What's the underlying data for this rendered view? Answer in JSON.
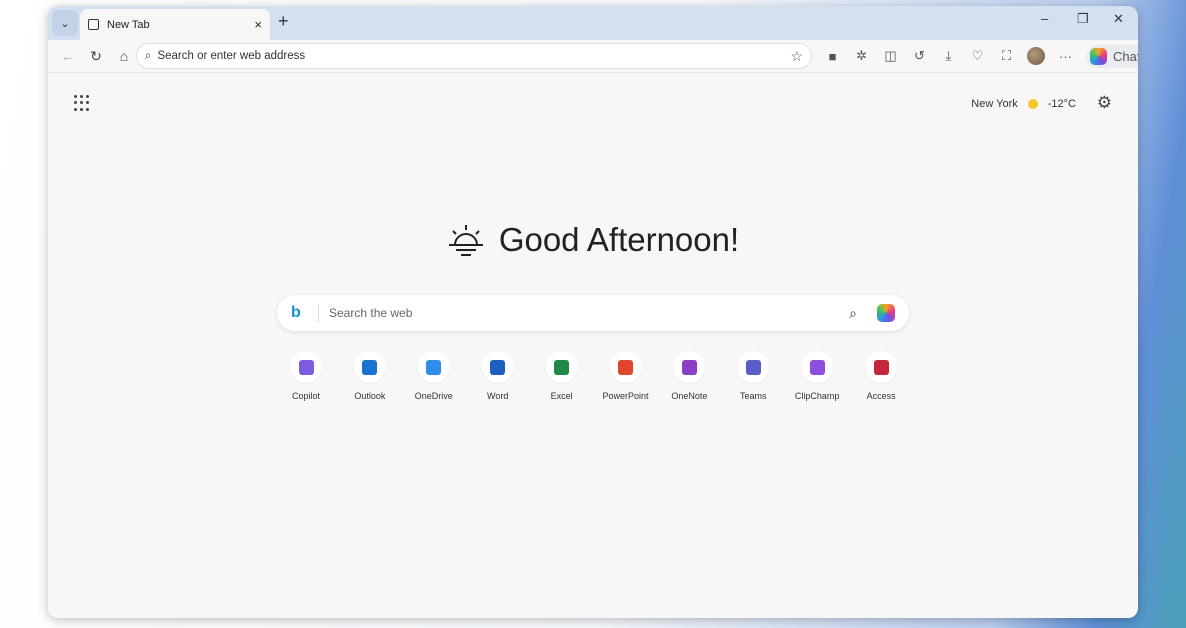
{
  "tab": {
    "title": "New Tab",
    "close": "×",
    "new": "+",
    "menu": "⌄"
  },
  "window": {
    "minimize": "–",
    "restore": "❐",
    "close": "✕"
  },
  "toolbar": {
    "back": "←",
    "refresh": "↻",
    "home": "⌂",
    "address_placeholder": "Search or enter web address",
    "favorite": "☆",
    "chat_label": "Chat",
    "more": "···"
  },
  "weather": {
    "city": "New York",
    "temp": "-12°C"
  },
  "greeting": "Good Afternoon!",
  "search": {
    "placeholder": "Search the web",
    "bing": "b"
  },
  "shortcuts": [
    {
      "label": "Copilot",
      "color": "#7b5be0"
    },
    {
      "label": "Outlook",
      "color": "#1a73d0"
    },
    {
      "label": "OneDrive",
      "color": "#2f8fe8"
    },
    {
      "label": "Word",
      "color": "#1d5fbf"
    },
    {
      "label": "Excel",
      "color": "#1f8a47"
    },
    {
      "label": "PowerPoint",
      "color": "#e0462d"
    },
    {
      "label": "OneNote",
      "color": "#8a3fc4"
    },
    {
      "label": "Teams",
      "color": "#5a5fc8"
    },
    {
      "label": "ClipChamp",
      "color": "#8e4fe0"
    },
    {
      "label": "Access",
      "color": "#c4263b"
    }
  ]
}
